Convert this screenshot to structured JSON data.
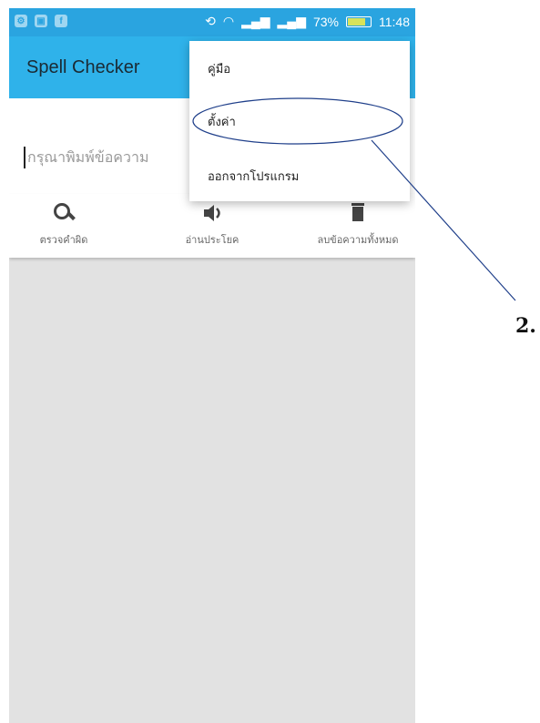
{
  "status_bar": {
    "battery_percent": "73%",
    "time": "11:48",
    "left_icons": [
      "settings-icon",
      "image-icon",
      "facebook-icon"
    ],
    "right_icons": [
      "rotate-icon",
      "wifi-icon",
      "signal-icon",
      "signal-icon",
      "battery-icon"
    ]
  },
  "app_bar": {
    "title": "Spell Checker"
  },
  "input": {
    "placeholder": "กรุณาพิมพ์ข้อความ",
    "value": ""
  },
  "actions": [
    {
      "label": "ตรวจคำผิด",
      "icon": "search-icon"
    },
    {
      "label": "อ่านประโยค",
      "icon": "speaker-icon"
    },
    {
      "label": "ลบข้อความทั้งหมด",
      "icon": "trash-icon"
    }
  ],
  "menu": {
    "items": [
      {
        "label": "คู่มือ"
      },
      {
        "label": "ตั้งค่า"
      },
      {
        "label": "ออกจากโปรแกรม"
      }
    ]
  },
  "annotation": {
    "label": "2."
  },
  "colors": {
    "status_bar": "#2aa4e0",
    "app_bar": "#2fb2ea",
    "content_bg": "#e2e2e2",
    "annotation": "#1f3f8a"
  }
}
